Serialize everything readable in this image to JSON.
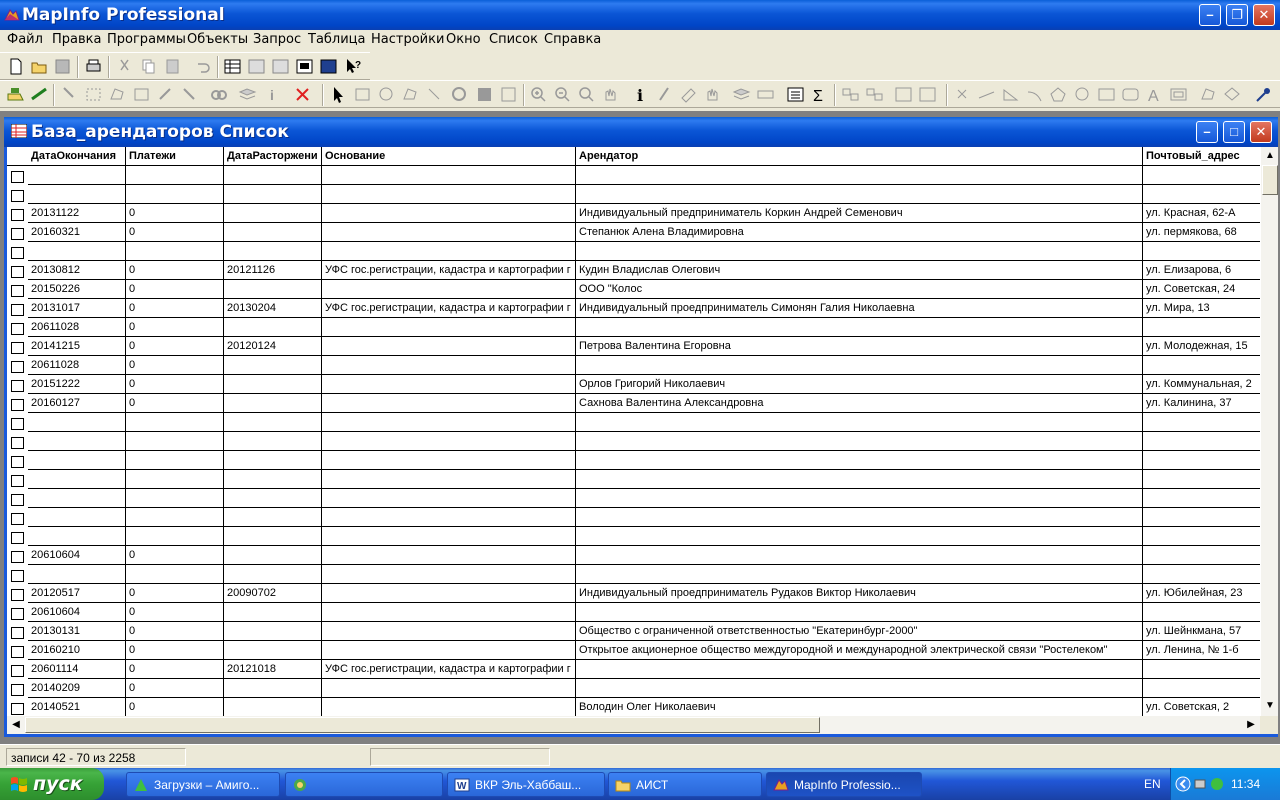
{
  "app": {
    "title": "MapInfo Professional"
  },
  "menu": [
    "Файл",
    "Правка",
    "Программы",
    "Объекты",
    "Запрос",
    "Таблица",
    "Настройки",
    "Окно",
    "Список",
    "Справка"
  ],
  "window": {
    "title": "База_арендаторов Список"
  },
  "table": {
    "columns": [
      "ДатаОкончания",
      "Платежи",
      "ДатаРасторжени",
      "Основание",
      "Арендатор",
      "Почтовый_адрес"
    ],
    "rows": [
      [
        "",
        "",
        "",
        "",
        "",
        ""
      ],
      [
        "",
        "",
        "",
        "",
        "",
        ""
      ],
      [
        "20131122",
        "0",
        "",
        "",
        "Индивидуальный предприниматель Коркин Андрей Семенович",
        "ул. Красная, 62-А"
      ],
      [
        "20160321",
        "0",
        "",
        "",
        "Степанюк Алена Владимировна",
        "ул. пермякова, 68"
      ],
      [
        "",
        "",
        "",
        "",
        "",
        ""
      ],
      [
        "20130812",
        "0",
        "20121126",
        "УФС гос.регистрации, кадастра и картографии г",
        "Кудин Владислав Олегович",
        "ул. Елизарова, 6"
      ],
      [
        "20150226",
        "0",
        "",
        "",
        "ООО \"Колос",
        "ул. Советская, 24"
      ],
      [
        "20131017",
        "0",
        "20130204",
        "УФС гос.регистрации, кадастра и картографии г",
        "Индивидуальный проедприниматель Симонян Галия Николаевна",
        "ул. Мира, 13"
      ],
      [
        "20611028",
        "0",
        "",
        "",
        "",
        ""
      ],
      [
        "20141215",
        "0",
        "20120124",
        "",
        "Петрова Валентина Егоровна",
        "ул. Молодежная, 15"
      ],
      [
        "20611028",
        "0",
        "",
        "",
        "",
        ""
      ],
      [
        "20151222",
        "0",
        "",
        "",
        "Орлов Григорий Николаевич",
        "ул. Коммунальная, 2"
      ],
      [
        "20160127",
        "0",
        "",
        "",
        "Сахнова Валентина Александровна",
        "ул. Калинина, 37"
      ],
      [
        "",
        "",
        "",
        "",
        "",
        ""
      ],
      [
        "",
        "",
        "",
        "",
        "",
        ""
      ],
      [
        "",
        "",
        "",
        "",
        "",
        ""
      ],
      [
        "",
        "",
        "",
        "",
        "",
        ""
      ],
      [
        "",
        "",
        "",
        "",
        "",
        ""
      ],
      [
        "",
        "",
        "",
        "",
        "",
        ""
      ],
      [
        "",
        "",
        "",
        "",
        "",
        ""
      ],
      [
        "20610604",
        "0",
        "",
        "",
        "",
        ""
      ],
      [
        "",
        "",
        "",
        "",
        "",
        ""
      ],
      [
        "20120517",
        "0",
        "20090702",
        "",
        "Индивидуальный проедприниматель Рудаков Виктор Николаевич",
        "ул. Юбилейная, 23"
      ],
      [
        "20610604",
        "0",
        "",
        "",
        "",
        ""
      ],
      [
        "20130131",
        "0",
        "",
        "",
        "Общество с ограниченной ответственностью \"Екатеринбург-2000\"",
        "ул. Шейнкмана, 57"
      ],
      [
        "20160210",
        "0",
        "",
        "",
        "Открытое акционерное общество междугородной и международной электрической связи \"Ростелеком\"",
        "ул. Ленина, № 1-б"
      ],
      [
        "20601114",
        "0",
        "20121018",
        "УФС гос.регистрации, кадастра и картографии г",
        "",
        ""
      ],
      [
        "20140209",
        "0",
        "",
        "",
        "",
        ""
      ],
      [
        "20140521",
        "0",
        "",
        "",
        "Володин Олег Николаевич",
        "ул. Советская, 2"
      ]
    ]
  },
  "status": {
    "records": "записи 42 - 70 из 2258"
  },
  "taskbar": {
    "start": "пуск",
    "tasks": [
      "Загрузки – Амиго...",
      "",
      "ВКР Эль-Хаббаш...",
      "АИСТ",
      "MapInfo Professio..."
    ],
    "lang": "EN",
    "clock": "11:34"
  },
  "colors": {
    "titlebar": "#0A5FD8",
    "start": "#36A236",
    "taskbar": "#2157D7"
  }
}
